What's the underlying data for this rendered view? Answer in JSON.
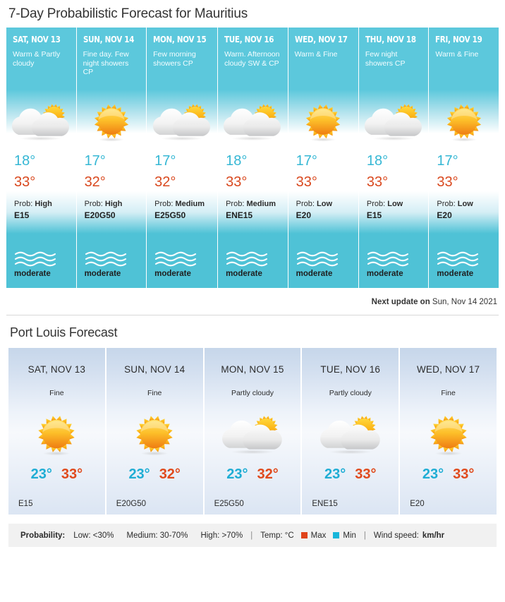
{
  "header": {
    "title": "7-Day Probabilistic Forecast for Mauritius"
  },
  "week_forecast": {
    "next_update_label": "Next update on",
    "next_update_value": "Sun, Nov 14 2021",
    "days": [
      {
        "day": "SAT, NOV 13",
        "description": "Warm & Partly cloudy",
        "icon": "partly-cloudy-icon",
        "temp_min": "18°",
        "temp_max": "33°",
        "prob_label": "Prob:",
        "prob_value": "High",
        "wind": "E15",
        "sea_icon": "waves-icon",
        "sea_state": "moderate"
      },
      {
        "day": "SUN, NOV 14",
        "description": "Fine day. Few night showers CP",
        "icon": "sunny-icon",
        "temp_min": "17°",
        "temp_max": "32°",
        "prob_label": "Prob:",
        "prob_value": "High",
        "wind": "E20G50",
        "sea_icon": "waves-icon",
        "sea_state": "moderate"
      },
      {
        "day": "MON, NOV 15",
        "description": "Few morning showers CP",
        "icon": "partly-cloudy-icon",
        "temp_min": "17°",
        "temp_max": "32°",
        "prob_label": "Prob:",
        "prob_value": "Medium",
        "wind": "E25G50",
        "sea_icon": "waves-icon",
        "sea_state": "moderate"
      },
      {
        "day": "TUE, NOV 16",
        "description": "Warm. Afternoon cloudy SW & CP",
        "icon": "partly-cloudy-icon",
        "temp_min": "18°",
        "temp_max": "33°",
        "prob_label": "Prob:",
        "prob_value": "Medium",
        "wind": "ENE15",
        "sea_icon": "waves-icon",
        "sea_state": "moderate"
      },
      {
        "day": "WED, NOV 17",
        "description": "Warm & Fine",
        "icon": "sunny-icon",
        "temp_min": "17°",
        "temp_max": "33°",
        "prob_label": "Prob:",
        "prob_value": "Low",
        "wind": "E20",
        "sea_icon": "waves-icon",
        "sea_state": "moderate"
      },
      {
        "day": "THU, NOV 18",
        "description": "Few night showers CP",
        "icon": "partly-cloudy-icon",
        "temp_min": "18°",
        "temp_max": "33°",
        "prob_label": "Prob:",
        "prob_value": "Low",
        "wind": "E15",
        "sea_icon": "waves-icon",
        "sea_state": "moderate"
      },
      {
        "day": "FRI, NOV 19",
        "description": "Warm & Fine",
        "icon": "sunny-icon",
        "temp_min": "17°",
        "temp_max": "33°",
        "prob_label": "Prob:",
        "prob_value": "Low",
        "wind": "E20",
        "sea_icon": "waves-icon",
        "sea_state": "moderate"
      }
    ]
  },
  "port_louis": {
    "title": "Port Louis Forecast",
    "days": [
      {
        "day": "SAT, NOV 13",
        "description": "Fine",
        "icon": "sunny-icon",
        "temp_min": "23°",
        "temp_max": "33°",
        "wind": "E15"
      },
      {
        "day": "SUN, NOV 14",
        "description": "Fine",
        "icon": "sunny-icon",
        "temp_min": "23°",
        "temp_max": "32°",
        "wind": "E20G50"
      },
      {
        "day": "MON, NOV 15",
        "description": "Partly cloudy",
        "icon": "partly-cloudy-icon",
        "temp_min": "23°",
        "temp_max": "32°",
        "wind": "E25G50"
      },
      {
        "day": "TUE, NOV 16",
        "description": "Partly cloudy",
        "icon": "partly-cloudy-icon",
        "temp_min": "23°",
        "temp_max": "33°",
        "wind": "ENE15"
      },
      {
        "day": "WED, NOV 17",
        "description": "Fine",
        "icon": "sunny-icon",
        "temp_min": "23°",
        "temp_max": "33°",
        "wind": "E20"
      }
    ]
  },
  "legend": {
    "probability_label": "Probability:",
    "low": "Low: <30%",
    "medium": "Medium: 30-70%",
    "high": "High: >70%",
    "sep1": "|",
    "temp_label": "Temp: °C",
    "max_label": "Max",
    "min_label": "Min",
    "sep2": "|",
    "wind_label": "Wind speed:",
    "wind_unit": "km/hr"
  },
  "colors": {
    "panel_cyan": "#5cc8dc",
    "temp_min_blue": "#35b7d4",
    "temp_max_red": "#d9491f",
    "legend_max_swatch": "#e0431a",
    "legend_min_swatch": "#17b6da",
    "port_louis_bg": "#c6d6ea"
  }
}
